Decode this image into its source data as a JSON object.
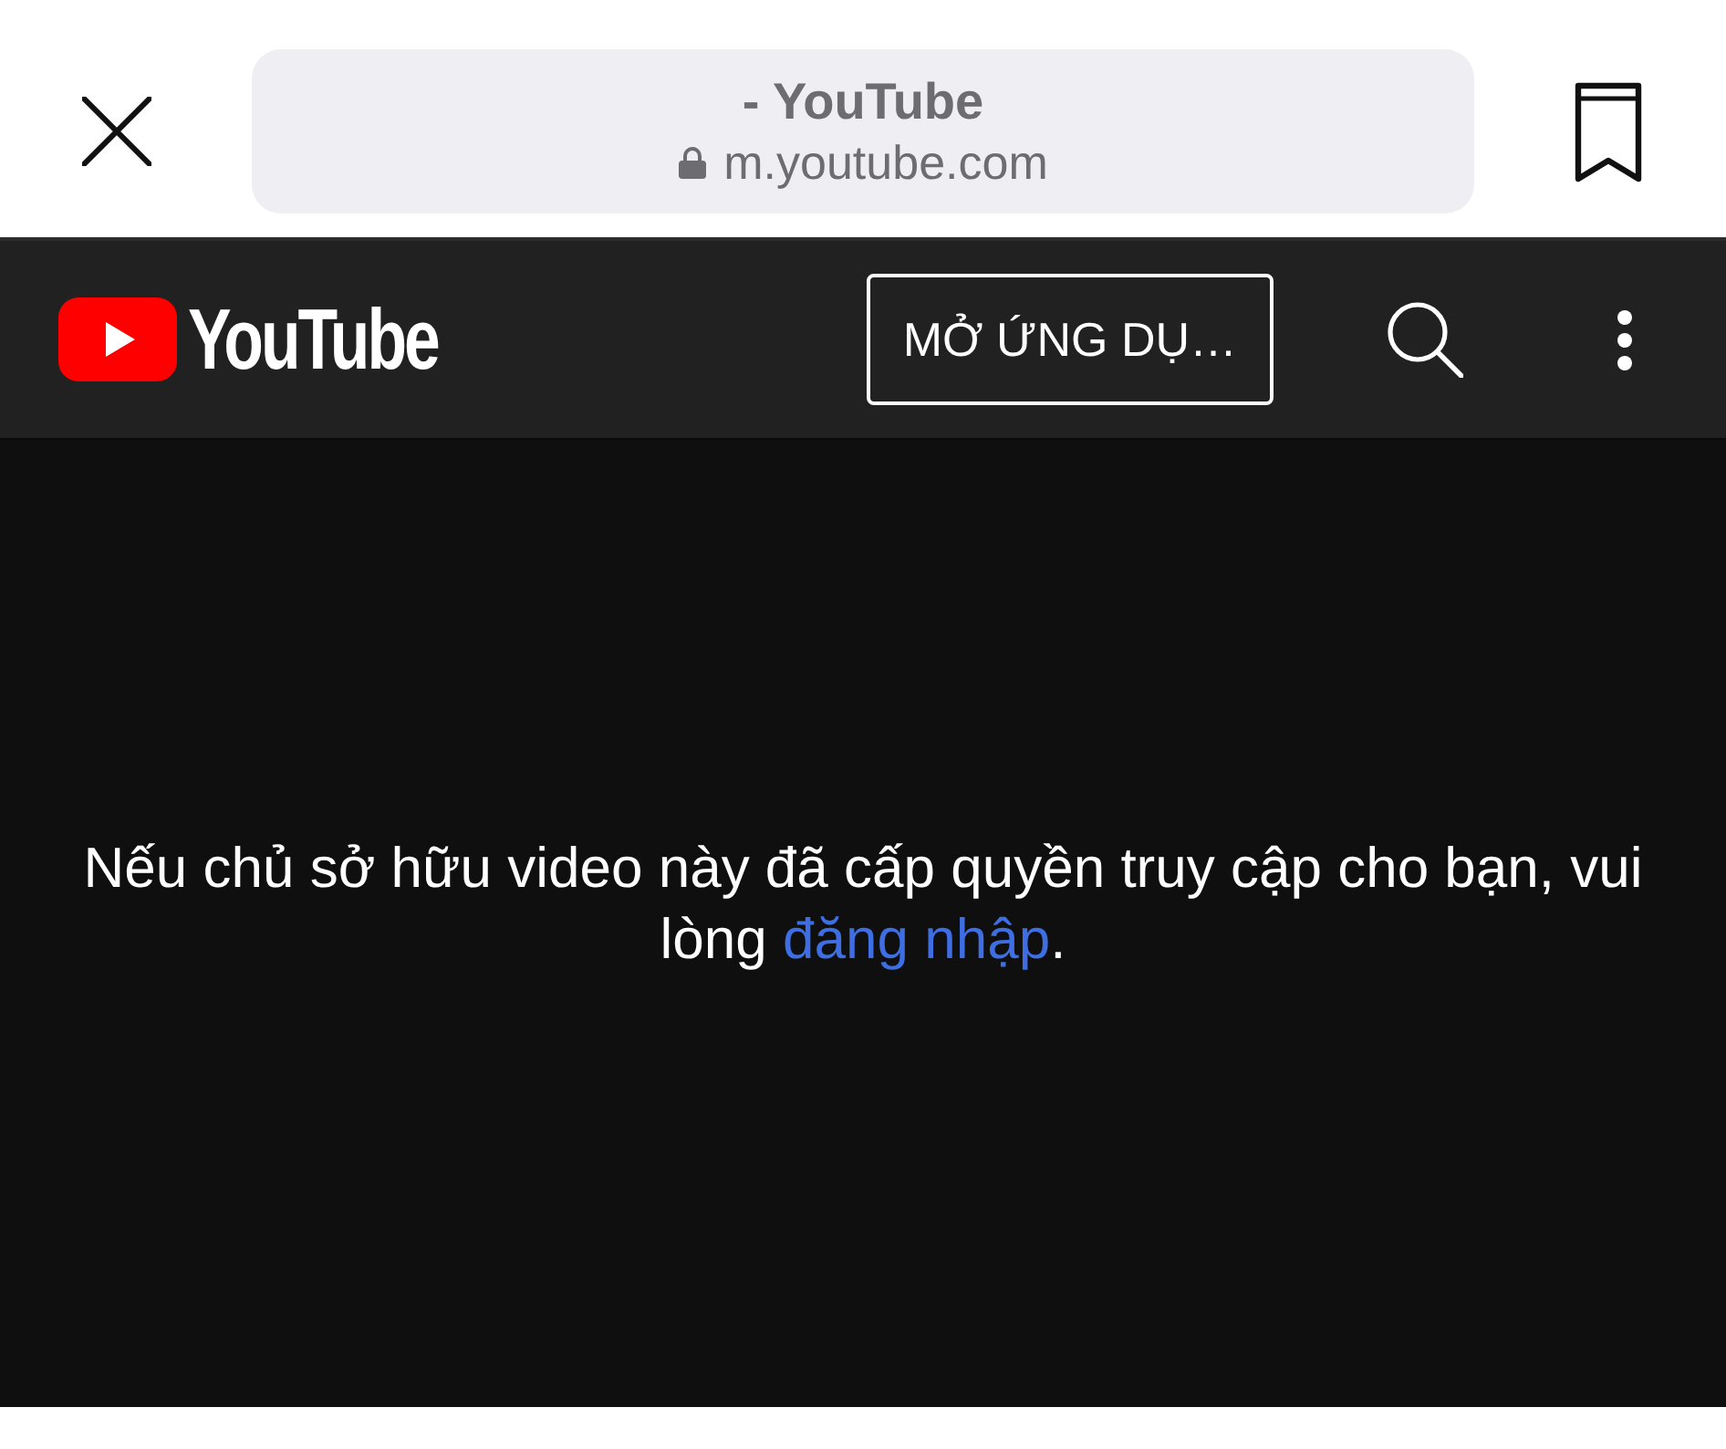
{
  "browser_bar": {
    "page_title": "- YouTube",
    "url": "m.youtube.com"
  },
  "header": {
    "logo_text": "YouTube",
    "open_app_button": "MỞ ỨNG DỤ…"
  },
  "player_message": {
    "text": "Nếu chủ sở hữu video này đã cấp quyền truy cập cho bạn, vui lòng ",
    "link": "đăng nhập",
    "text_after": "."
  }
}
